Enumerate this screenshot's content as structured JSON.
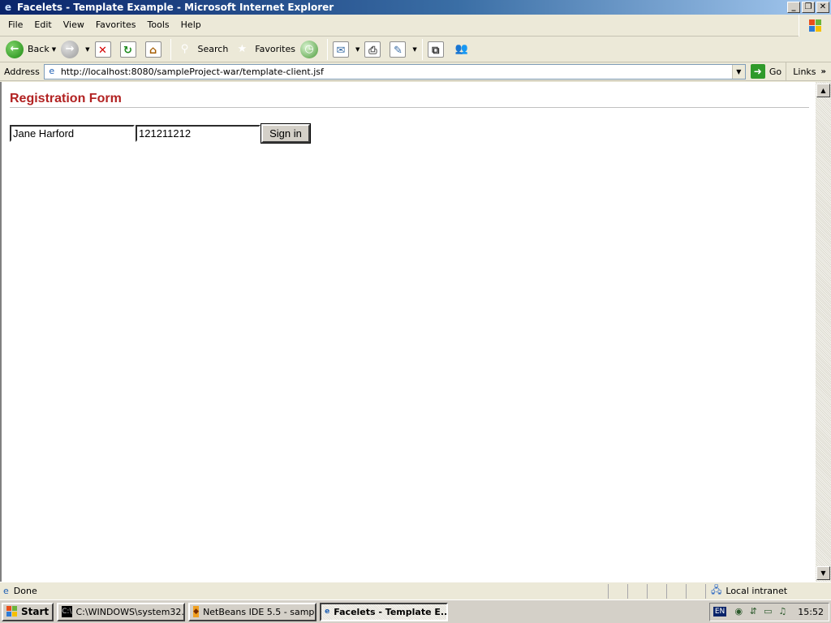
{
  "window": {
    "title": "Facelets - Template Example - Microsoft Internet Explorer",
    "icons": {
      "app": "ie-icon",
      "minimize": "minimize-icon",
      "maximize": "restore-icon",
      "close": "close-icon"
    }
  },
  "menu": [
    "File",
    "Edit",
    "View",
    "Favorites",
    "Tools",
    "Help"
  ],
  "toolbar": {
    "back": "Back",
    "search": "Search",
    "favorites": "Favorites"
  },
  "address": {
    "label": "Address",
    "url": "http://localhost:8080/sampleProject-war/template-client.jsf",
    "go": "Go",
    "links": "Links"
  },
  "page": {
    "title": "Registration Form",
    "name_value": "Jane Harford",
    "password_value": "121211212",
    "signin_label": "Sign in"
  },
  "status": {
    "text": "Done",
    "zone": "Local intranet"
  },
  "taskbar": {
    "start": "Start",
    "tasks": [
      {
        "label": "C:\\WINDOWS\\system32...",
        "icon": "cmd-icon",
        "active": false
      },
      {
        "label": "NetBeans IDE 5.5 - samp...",
        "icon": "netbeans-icon",
        "active": false
      },
      {
        "label": "Facelets - Template E...",
        "icon": "ie-icon",
        "active": true
      }
    ],
    "language": "EN",
    "clock": "15:52"
  },
  "colors": {
    "title_gradient_start": "#0a246a",
    "page_title": "#b22222",
    "chrome": "#ece9d8"
  }
}
